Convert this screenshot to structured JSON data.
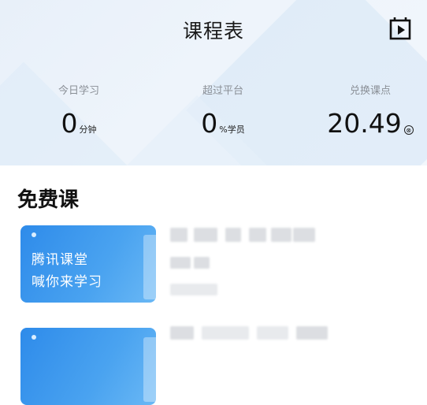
{
  "header": {
    "title": "课程表",
    "play_icon": "play-icon"
  },
  "stats": [
    {
      "label": "今日学习",
      "value": "0",
      "unit": "分钟"
    },
    {
      "label": "超过平台",
      "value": "0",
      "unit": "%学员"
    },
    {
      "label": "兑换课点",
      "value": "20.49",
      "unit_icon": "coin-icon",
      "unit_glyph": "⊗"
    }
  ],
  "free_courses": {
    "title": "免费课",
    "items": [
      {
        "thumb_line1": "腾讯课堂",
        "thumb_line2": "喊你来学习"
      },
      {
        "thumb_line1": "",
        "thumb_line2": ""
      }
    ]
  },
  "colors": {
    "header_bg": "#e8f0f9",
    "thumb_blue": "#2e8bea"
  }
}
